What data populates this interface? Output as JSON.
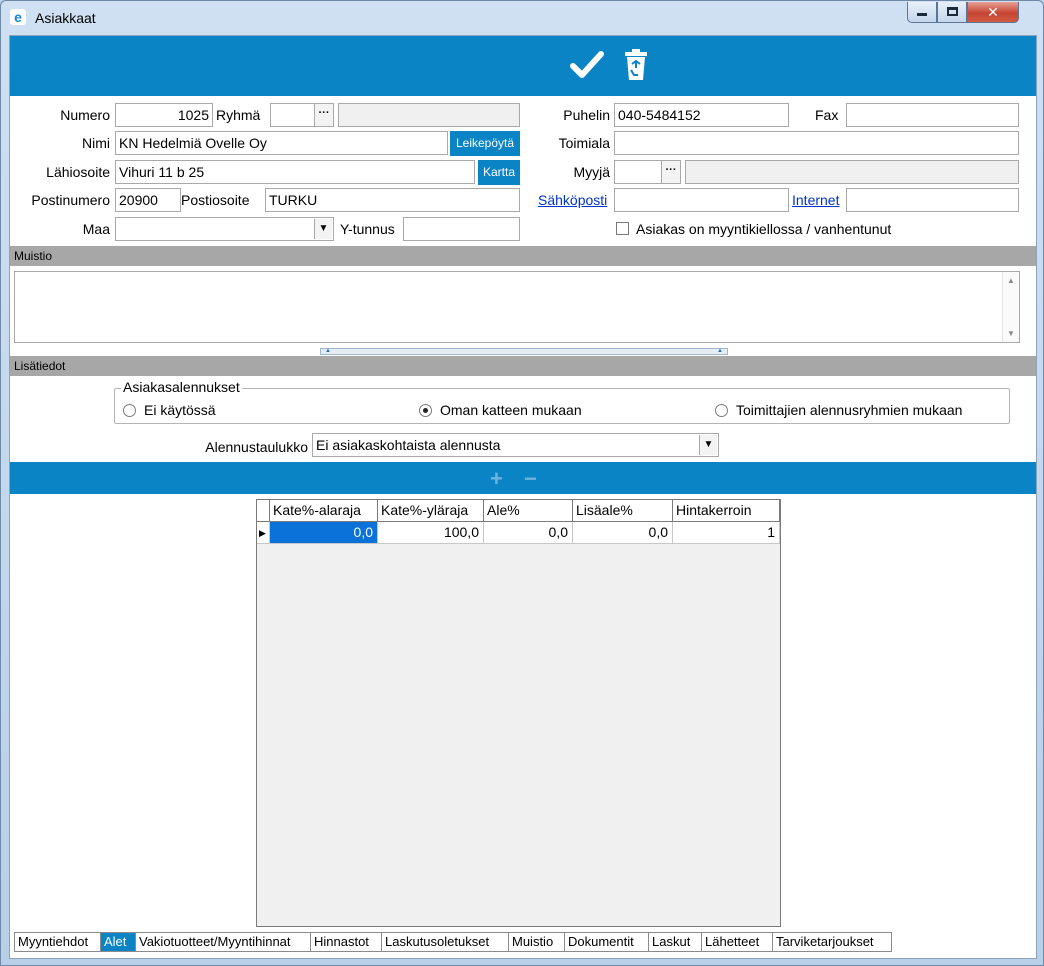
{
  "window": {
    "title": "Asiakkaat"
  },
  "form": {
    "numero_label": "Numero",
    "numero_value": "1025",
    "ryhma_label": "Ryhmä",
    "ryhma_value": "",
    "ryhma_name": "",
    "nimi_label": "Nimi",
    "nimi_value": "KN Hedelmiä Ovelle Oy",
    "leikepoyta_button": "Leikepöytä",
    "lahiosoite_label": "Lähiosoite",
    "lahiosoite_value": "Vihuri 11 b 25",
    "kartta_button": "Kartta",
    "postinumero_label": "Postinumero",
    "postinumero_value": "20900",
    "postiosoite_label": "Postiosoite",
    "postiosoite_value": "TURKU",
    "maa_label": "Maa",
    "maa_value": "",
    "ytunnus_label": "Y-tunnus",
    "ytunnus_value": "",
    "puhelin_label": "Puhelin",
    "puhelin_value": "040-5484152",
    "fax_label": "Fax",
    "fax_value": "",
    "toimiala_label": "Toimiala",
    "toimiala_value": "",
    "myyja_label": "Myyjä",
    "myyja_value": "",
    "myyja_name": "",
    "sahkoposti_link": "Sähköposti",
    "sahkoposti_value": "",
    "internet_link": "Internet",
    "internet_value": "",
    "myyntikielto_label": "Asiakas on myyntikiellossa / vanhentunut"
  },
  "muistio": {
    "header": "Muistio",
    "text": ""
  },
  "lisatiedot": {
    "header": "Lisätiedot",
    "group_label": "Asiakasalennukset",
    "radios": [
      {
        "label": "Ei käytössä",
        "selected": false
      },
      {
        "label": "Oman katteen mukaan",
        "selected": true
      },
      {
        "label": "Toimittajien alennusryhmien mukaan",
        "selected": false
      }
    ],
    "alennustaulukko_label": "Alennustaulukko",
    "alennustaulukko_value": "Ei asiakaskohtaista alennusta"
  },
  "grid": {
    "columns": [
      "Kate%-alaraja",
      "Kate%-yläraja",
      "Ale%",
      "Lisäale%",
      "Hintakerroin"
    ],
    "rows": [
      [
        "0,0",
        "100,0",
        "0,0",
        "0,0",
        "1"
      ]
    ]
  },
  "tabs": [
    "Myyntiehdot",
    "Alet",
    "Vakiotuotteet/Myyntihinnat",
    "Hinnastot",
    "Laskutusoletukset",
    "Muistio",
    "Dokumentit",
    "Laskut",
    "Lähetteet",
    "Tarviketarjoukset"
  ],
  "active_tab": "Alet",
  "colors": {
    "accent": "#0b84c6",
    "section_bar": "#a7a7a7",
    "selection": "#0a72d9"
  }
}
